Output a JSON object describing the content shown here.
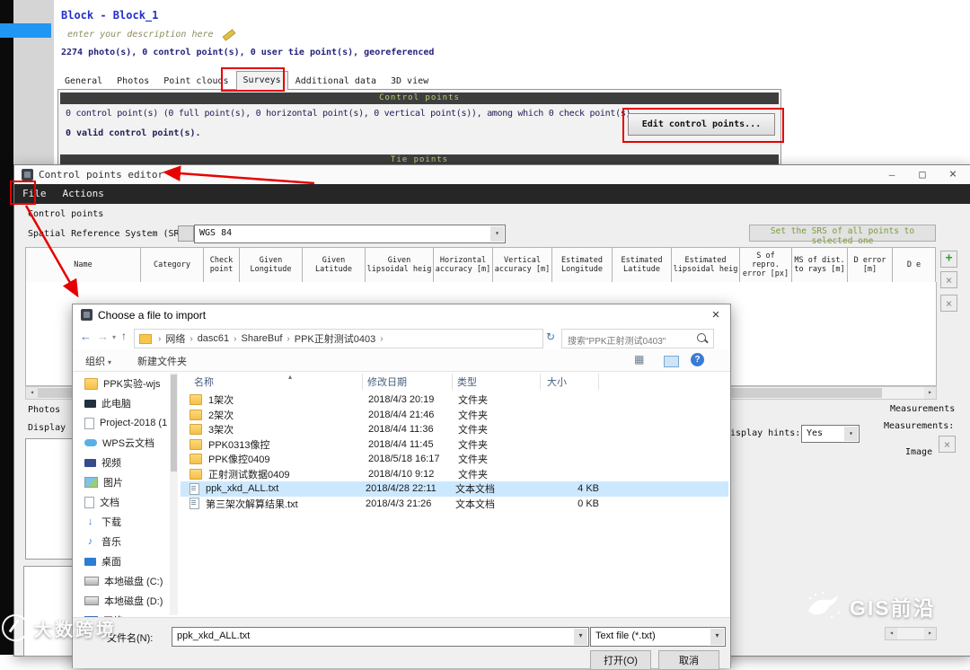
{
  "app": {
    "block_title": "Block - Block_1",
    "description_placeholder": "enter your description here",
    "summary": "2274 photo(s), 0 control point(s), 0 user tie point(s), georeferenced",
    "tabs": [
      {
        "label": "General"
      },
      {
        "label": "Photos"
      },
      {
        "label": "Point clouds"
      },
      {
        "label": "Surveys"
      },
      {
        "label": "Additional data"
      },
      {
        "label": "3D view"
      }
    ],
    "control_points_header": "Control points",
    "control_points_line1": "0 control point(s) (0 full point(s), 0 horizontal point(s), 0 vertical point(s)), among which 0 check point(s).",
    "control_points_line2": "0 valid control point(s).",
    "edit_button": "Edit control points...",
    "tie_points_header": "Tie points"
  },
  "editor": {
    "title": "Control points editor",
    "menu": [
      "File",
      "Actions"
    ],
    "section_label": "Control points",
    "srs_label": "Spatial Reference System (SRS):",
    "srs_value": "WGS 84",
    "set_srs_button": "Set the SRS of all points to selected one",
    "columns": [
      "Name",
      "Category",
      "Check point",
      "Given Longitude",
      "Given Latitude",
      "Given lipsoidal heig",
      "Horizontal accuracy [m]",
      "Vertical accuracy [m]",
      "Estimated Longitude",
      "Estimated Latitude",
      "Estimated lipsoidal heig",
      "S of repro. error [px]",
      "MS of dist. to rays [m]",
      "D error [m]",
      "D e"
    ],
    "photos_label": "Photos",
    "display_label": "Display",
    "display_hints_label": "isplay hints:",
    "display_hints_value": "Yes",
    "measurements_title": "Measurements",
    "measurements_label": "Measurements:",
    "image_label": "Image"
  },
  "file_dialog": {
    "title": "Choose a file to import",
    "breadcrumb": [
      "网络",
      "dasc61",
      "ShareBuf",
      "PPK正射测试0403"
    ],
    "search_placeholder": "搜索\"PPK正射测试0403\"",
    "toolbar": {
      "organize": "组织",
      "new_folder": "新建文件夹"
    },
    "sidebar": [
      {
        "label": "PPK实验-wjs",
        "icon": "folder-icon"
      },
      {
        "label": "此电脑",
        "icon": "computer-icon"
      },
      {
        "label": "Project-2018 (1",
        "icon": "document-icon"
      },
      {
        "label": "WPS云文档",
        "icon": "cloud-icon"
      },
      {
        "label": "视频",
        "icon": "video-icon"
      },
      {
        "label": "图片",
        "icon": "picture-icon"
      },
      {
        "label": "文档",
        "icon": "document-icon"
      },
      {
        "label": "下载",
        "icon": "download-icon"
      },
      {
        "label": "音乐",
        "icon": "music-icon"
      },
      {
        "label": "桌面",
        "icon": "desktop-icon"
      },
      {
        "label": "本地磁盘 (C:)",
        "icon": "drive-icon"
      },
      {
        "label": "本地磁盘 (D:)",
        "icon": "drive-icon"
      },
      {
        "label": "网络",
        "icon": "network-icon"
      }
    ],
    "columns": [
      "名称",
      "修改日期",
      "类型",
      "大小"
    ],
    "files": [
      {
        "name": "1架次",
        "date": "2018/4/3 20:19",
        "type": "文件夹",
        "size": "",
        "icon": "folder-icon"
      },
      {
        "name": "2架次",
        "date": "2018/4/4 21:46",
        "type": "文件夹",
        "size": "",
        "icon": "folder-icon"
      },
      {
        "name": "3架次",
        "date": "2018/4/4 11:36",
        "type": "文件夹",
        "size": "",
        "icon": "folder-icon"
      },
      {
        "name": "PPK0313像控",
        "date": "2018/4/4 11:45",
        "type": "文件夹",
        "size": "",
        "icon": "folder-icon"
      },
      {
        "name": "PPK像控0409",
        "date": "2018/5/18 16:17",
        "type": "文件夹",
        "size": "",
        "icon": "folder-icon"
      },
      {
        "name": "正射测试数据0409",
        "date": "2018/4/10 9:12",
        "type": "文件夹",
        "size": "",
        "icon": "folder-icon"
      },
      {
        "name": "ppk_xkd_ALL.txt",
        "date": "2018/4/28 22:11",
        "type": "文本文档",
        "size": "4 KB",
        "icon": "text-file-icon",
        "selected": true
      },
      {
        "name": "第三架次解算结果.txt",
        "date": "2018/4/3 21:26",
        "type": "文本文档",
        "size": "0 KB",
        "icon": "text-file-icon"
      }
    ],
    "filename_label": "文件名(N):",
    "filename_value": "ppk_xkd_ALL.txt",
    "filetype_value": "Text file (*.txt)",
    "open_button": "打开(O)",
    "cancel_button": "取消"
  },
  "watermarks": {
    "left_text": "大数跨境",
    "right_text": "GIS前沿"
  }
}
